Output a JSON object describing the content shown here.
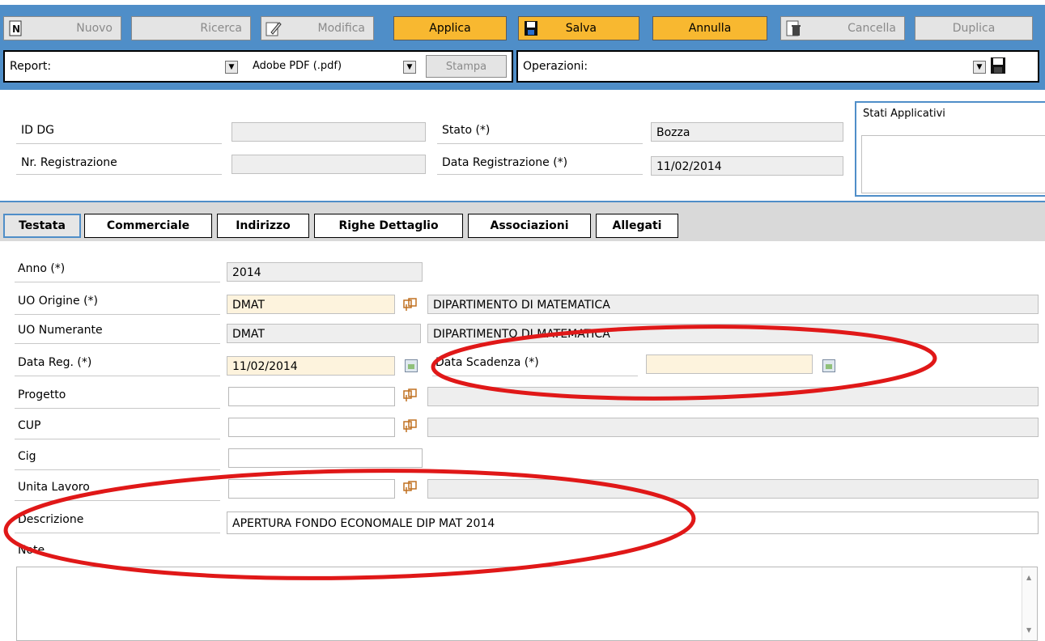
{
  "toolbar": {
    "nuovo": "Nuovo",
    "ricerca": "Ricerca",
    "modifica": "Modifica",
    "applica": "Applica",
    "salva": "Salva",
    "annulla": "Annulla",
    "cancella": "Cancella",
    "duplica": "Duplica"
  },
  "report_bar": {
    "report_label": "Report:",
    "report_value": "",
    "format_value": "Adobe PDF (.pdf)",
    "stampa": "Stampa",
    "operazioni_label": "Operazioni:",
    "operazioni_value": ""
  },
  "header": {
    "id_dg_label": "ID DG",
    "id_dg_value": "",
    "nr_reg_label": "Nr. Registrazione",
    "nr_reg_value": "",
    "stato_label": "Stato (*)",
    "stato_value": "Bozza",
    "data_reg_label": "Data Registrazione (*)",
    "data_reg_value": "11/02/2014",
    "stati_applicativi_label": "Stati Applicativi"
  },
  "tabs": [
    "Testata",
    "Commerciale",
    "Indirizzo",
    "Righe Dettaglio",
    "Associazioni",
    "Allegati"
  ],
  "form": {
    "anno_label": "Anno (*)",
    "anno_value": "2014",
    "uo_origine_label": "UO Origine (*)",
    "uo_origine_code": "DMAT",
    "uo_origine_desc": "DIPARTIMENTO DI MATEMATICA",
    "uo_numerante_label": "UO Numerante",
    "uo_numerante_code": "DMAT",
    "uo_numerante_desc": "DIPARTIMENTO DI MATEMATICA",
    "data_reg_label": "Data Reg. (*)",
    "data_reg_value": "11/02/2014",
    "data_scadenza_label": "Data Scadenza (*)",
    "data_scadenza_value": "",
    "progetto_label": "Progetto",
    "cup_label": "CUP",
    "cig_label": "Cig",
    "unita_lavoro_label": "Unita Lavoro",
    "descrizione_label": "Descrizione",
    "descrizione_value": "APERTURA FONDO ECONOMALE DIP MAT 2014",
    "note_label": "Note"
  }
}
